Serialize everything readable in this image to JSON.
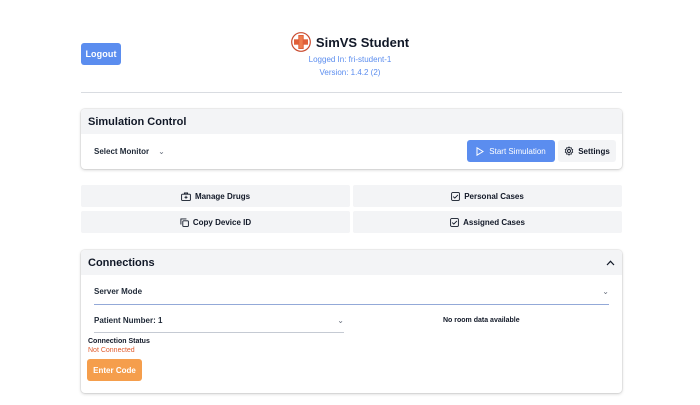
{
  "header": {
    "logout_label": "Logout",
    "app_title": "SimVS Student",
    "logged_in": "Logged In: fri-student-1",
    "version": "Version: 1.4.2 (2)"
  },
  "simulation": {
    "title": "Simulation Control",
    "select_monitor": "Select Monitor",
    "start_label": "Start Simulation",
    "settings_label": "Settings"
  },
  "tiles": {
    "manage_drugs": "Manage Drugs",
    "personal_cases": "Personal Cases",
    "copy_device_id": "Copy Device ID",
    "assigned_cases": "Assigned Cases"
  },
  "connections": {
    "title": "Connections",
    "server_mode": "Server Mode",
    "patient_number": "Patient Number: 1",
    "no_room": "No room data available",
    "status_label": "Connection Status",
    "status_value": "Not Connected",
    "enter_code": "Enter Code"
  },
  "colors": {
    "accent": "#5b8def",
    "orange": "#f59e4c",
    "error": "#e05a2b"
  }
}
